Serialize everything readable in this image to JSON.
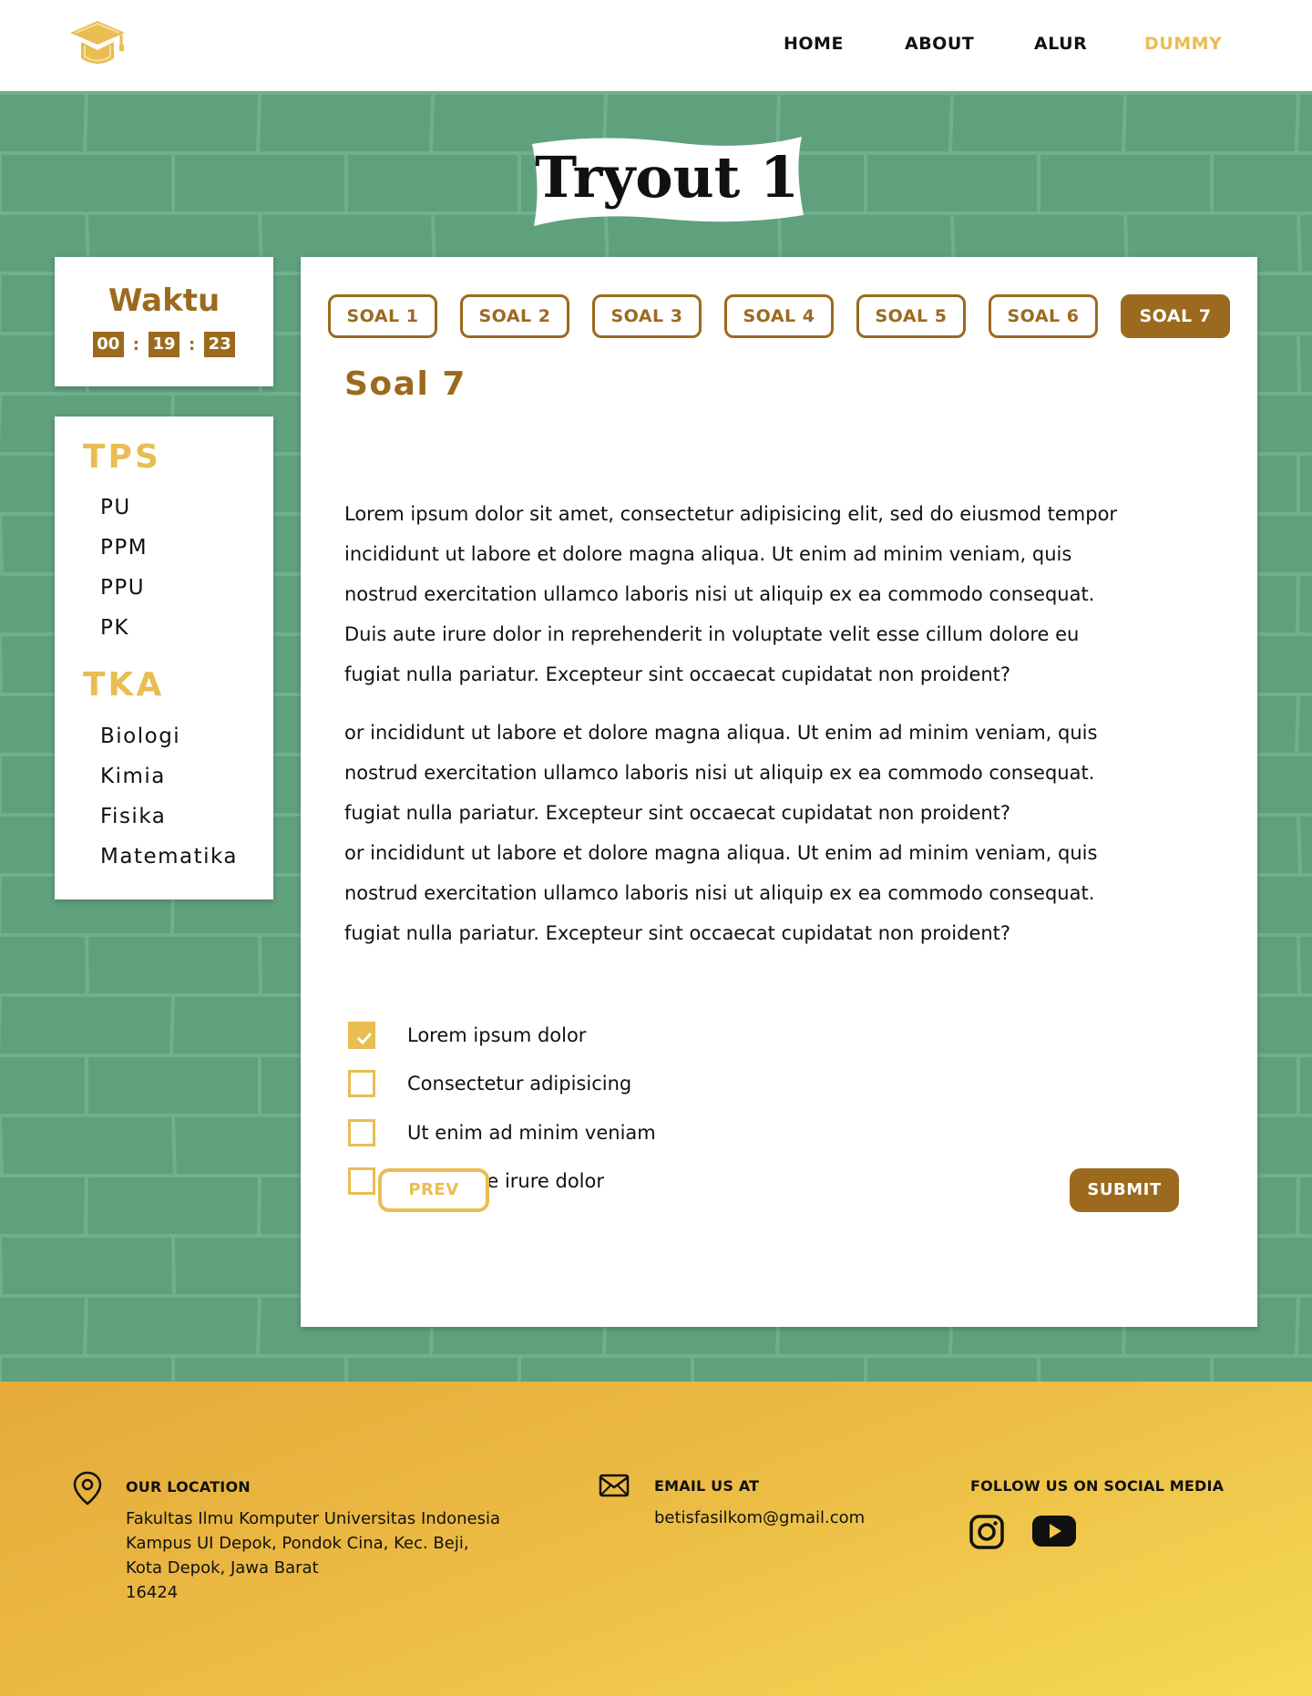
{
  "nav": {
    "logo_icon": "graduation-cap-icon",
    "links": [
      {
        "label": "HOME",
        "active": false
      },
      {
        "label": "ABOUT",
        "active": false
      },
      {
        "label": "ALUR",
        "active": false
      },
      {
        "label": "DUMMY",
        "active": true
      }
    ]
  },
  "page": {
    "title": "Tryout 1"
  },
  "timer": {
    "title": "Waktu",
    "hours": "00",
    "minutes": "19",
    "seconds": "23",
    "separator": ":"
  },
  "subjects": {
    "groups": [
      {
        "heading": "TPS",
        "items": [
          "PU",
          "PPM",
          "PPU",
          "PK"
        ]
      },
      {
        "heading": "TKA",
        "items": [
          "Biologi",
          "Kimia",
          "Fisika",
          "Matematika"
        ]
      }
    ]
  },
  "question": {
    "tabs": [
      {
        "label": "SOAL 1",
        "active": false
      },
      {
        "label": "SOAL 2",
        "active": false
      },
      {
        "label": "SOAL 3",
        "active": false
      },
      {
        "label": "SOAL 4",
        "active": false
      },
      {
        "label": "SOAL 5",
        "active": false
      },
      {
        "label": "SOAL 6",
        "active": false
      },
      {
        "label": "SOAL 7",
        "active": true
      }
    ],
    "title": "Soal 7",
    "lines": [
      "Lorem ipsum dolor sit amet, consectetur adipisicing elit, sed do eiusmod  tempor",
      "incididunt ut labore et dolore magna aliqua. Ut enim ad minim veniam,  quis",
      "nostrud exercitation ullamco laboris nisi ut aliquip ex ea commodo consequat.",
      "Duis aute irure dolor in reprehenderit in voluptate velit esse cillum dolore eu",
      "fugiat nulla pariatur. Excepteur sint occaecat cupidatat non proident?",
      "or incididunt ut labore et dolore magna aliqua. Ut enim ad minim veniam,  quis",
      "nostrud exercitation ullamco laboris nisi ut aliquip ex ea commodo consequat.",
      "fugiat nulla pariatur. Excepteur sint occaecat cupidatat non proident?",
      "or incididunt ut labore et dolore magna aliqua. Ut enim ad minim veniam,  quis",
      "nostrud exercitation ullamco laboris nisi ut aliquip ex ea commodo consequat.",
      "fugiat nulla pariatur. Excepteur sint occaecat cupidatat non proident?"
    ],
    "options": [
      {
        "label": "Lorem ipsum dolor",
        "checked": true
      },
      {
        "label": "Consectetur adipisicing",
        "checked": false
      },
      {
        "label": "Ut enim ad minim veniam",
        "checked": false
      },
      {
        "label": "Duis aute irure dolor",
        "checked": false
      }
    ],
    "prev_label": "PREV",
    "submit_label": "SUBMIT"
  },
  "footer": {
    "location": {
      "icon": "map-pin-icon",
      "heading": "OUR LOCATION",
      "lines": [
        "Fakultas Ilmu Komputer Universitas Indonesia",
        "Kampus UI Depok, Pondok Cina, Kec. Beji,",
        "Kota Depok, Jawa Barat",
        "16424"
      ]
    },
    "email": {
      "icon": "envelope-icon",
      "heading": "EMAIL US AT",
      "address": "betisfasilkom@gmail.com"
    },
    "social": {
      "heading": "FOLLOW US ON SOCIAL MEDIA",
      "icons": [
        "instagram-icon",
        "youtube-icon"
      ]
    }
  },
  "colors": {
    "primary_brown": "#9b6a1e",
    "accent_gold": "#e9bd52",
    "background_green": "#5fa07d",
    "footer_gold": "#ecbd45"
  }
}
